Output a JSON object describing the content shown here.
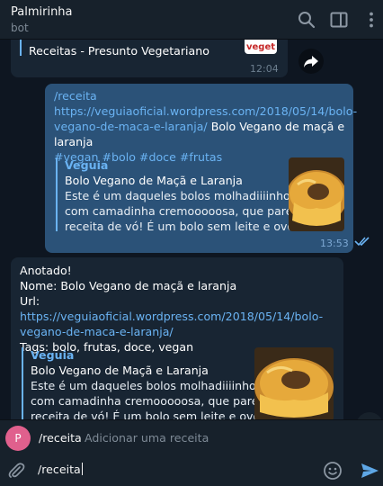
{
  "header": {
    "title": "Palmirinha",
    "subtitle": "bot"
  },
  "messages": {
    "forwarded_preview": {
      "text": "Receitas - Presunto Vegetariano",
      "thumb_label": "veget",
      "time": "12:04"
    },
    "outgoing": {
      "command": "/receita",
      "link": "https://veguiaoficial.wordpress.com/2018/05/14/bolo-vegano-de-maca-e-laranja/",
      "link_line1": "https://veguiaoficial.wordpress.com/2018/05/14/bolo-",
      "link_line2": "vegano-de-maca-e-laranja/",
      "title_after_link": " Bolo Vegano de maçã e laranja",
      "tags": "#vegan #bolo #doce #frutas",
      "preview": {
        "site": "Veguia",
        "title": "Bolo Vegano de Maçã e Laranja",
        "desc_line1": "Este é um daqueles bolos molhadiiiinhos,",
        "desc_line2": "com camadinha cremooooosa, que parece",
        "desc_line3": "receita de vó! É um bolo sem leite e ovos..."
      },
      "time": "13:53"
    },
    "incoming": {
      "line1": "Anotado!",
      "line2": " Nome: Bolo Vegano de maçã e laranja",
      "url_label": " Url: ",
      "link_line1": "https://veguiaoficial.wordpress.com/2018/05/14/bolo-",
      "link_line2": "vegano-de-maca-e-laranja/",
      "tags_line": " Tags: bolo, frutas, doce, vegan",
      "preview": {
        "site": "Veguia",
        "title": "Bolo Vegano de Maçã e Laranja",
        "desc_line1": "Este é um daqueles bolos molhadiiiinhos,",
        "desc_line2": "com camadinha cremooooosa, que parece",
        "desc_line3": "receita de vó! É um bolo sem leite e ovos..."
      }
    }
  },
  "command_suggestion": {
    "avatar_letter": "P",
    "command": "/receita",
    "description": "Adicionar uma receita"
  },
  "composer": {
    "value": "/receita"
  },
  "icons": {
    "search": "search-icon",
    "columns": "sidebar-toggle-icon",
    "menu": "more-vertical-icon",
    "forward": "forward-icon",
    "attach": "paperclip-icon",
    "emoji": "emoji-icon",
    "send": "send-icon",
    "read": "double-check-icon"
  },
  "colors": {
    "background": "#0e1621",
    "header": "#17212b",
    "outgoing_bubble": "#2b5278",
    "incoming_bubble": "#182533",
    "link": "#6ab3f3",
    "avatar": "#e0608d",
    "send": "#5ea7e6"
  }
}
